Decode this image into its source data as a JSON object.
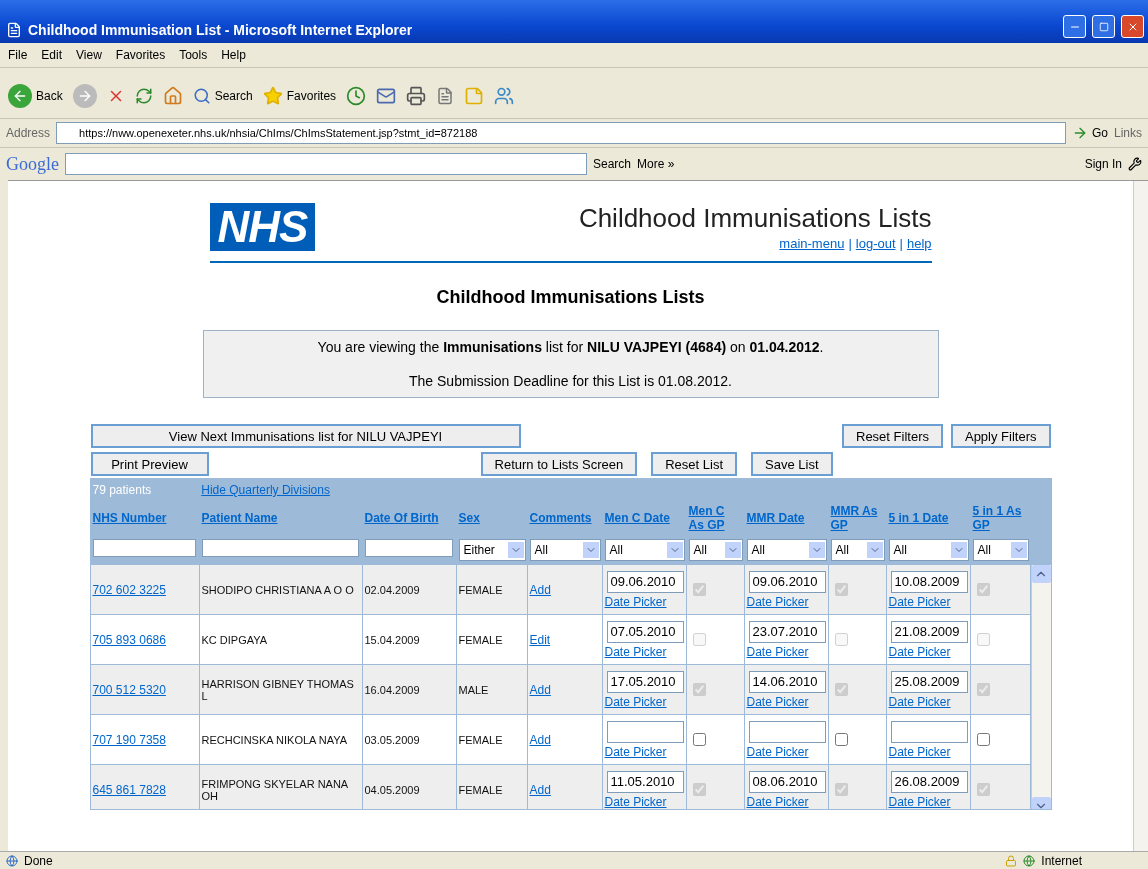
{
  "window": {
    "title": "Childhood Immunisation List - Microsoft Internet Explorer"
  },
  "menu": [
    "File",
    "Edit",
    "View",
    "Favorites",
    "Tools",
    "Help"
  ],
  "toolbar": {
    "back": "Back",
    "search": "Search",
    "favorites": "Favorites"
  },
  "address_bar": {
    "label": "Address",
    "url": "https://nww.openexeter.nhs.uk/nhsia/ChIms/ChImsStatement.jsp?stmt_id=872188",
    "go": "Go",
    "links": "Links"
  },
  "google_bar": {
    "logo": "Google",
    "search": "Search",
    "more": "More »",
    "sign_in": "Sign In"
  },
  "page": {
    "logo": "NHS",
    "title": "Childhood Immunisations Lists",
    "links": [
      {
        "label": "main-menu"
      },
      {
        "label": "log-out"
      },
      {
        "label": "help"
      }
    ],
    "separator": "|",
    "heading": "Childhood Immunisations Lists",
    "info": [
      "You are viewing the **Immunisations** list for **NILU VAJPEYI (4684)** on **01.04.2012**.",
      "The Submission Deadline for this List is 01.08.2012."
    ],
    "buttons_row1": {
      "left": "View Next Immunisations list for NILU VAJPEYI",
      "right": [
        "Reset Filters",
        "Apply Filters"
      ]
    },
    "buttons_row2": {
      "left": "Print Preview",
      "right": [
        "Return to Lists Screen",
        "Reset List",
        "Save List"
      ]
    },
    "table": {
      "count": "79 patients",
      "toggle": "Hide Quarterly Divisions",
      "columns": [
        {
          "label": "NHS Number",
          "filter": {
            "kind": "text"
          }
        },
        {
          "label": "Patient Name",
          "filter": {
            "kind": "text"
          }
        },
        {
          "label": "Date Of Birth",
          "filter": {
            "kind": "text"
          }
        },
        {
          "label": "Sex",
          "filter": {
            "kind": "select",
            "value": "Either"
          }
        },
        {
          "label": "Comments",
          "filter": {
            "kind": "select",
            "value": "All"
          }
        },
        {
          "label": "Men C Date",
          "filter": {
            "kind": "select",
            "value": "All"
          }
        },
        {
          "label": "Men C As GP",
          "filter": {
            "kind": "select",
            "value": "All"
          }
        },
        {
          "label": "MMR Date",
          "filter": {
            "kind": "select",
            "value": "All"
          }
        },
        {
          "label": "MMR As GP",
          "filter": {
            "kind": "select",
            "value": "All"
          }
        },
        {
          "label": "5 in 1 Date",
          "filter": {
            "kind": "select",
            "value": "All"
          }
        },
        {
          "label": "5 in 1 As GP",
          "filter": {
            "kind": "select",
            "value": "All"
          }
        }
      ],
      "rows": [
        {
          "nhs": "702 602 3225",
          "name": "SHODIPO CHRISTIANA A O O",
          "dob": "02.04.2009",
          "sex": "FEMALE",
          "comment": "Add",
          "vaccines": [
            {
              "date": "09.06.2010",
              "picker": "Date Picker",
              "checked": true,
              "disabled": true
            },
            {
              "date": "09.06.2010",
              "picker": "Date Picker",
              "checked": true,
              "disabled": true
            },
            {
              "date": "10.08.2009",
              "picker": "Date Picker",
              "checked": true,
              "disabled": true
            }
          ]
        },
        {
          "nhs": "705 893 0686",
          "name": "KC DIPGAYA",
          "dob": "15.04.2009",
          "sex": "FEMALE",
          "comment": "Edit",
          "vaccines": [
            {
              "date": "07.05.2010",
              "picker": "Date Picker",
              "checked": false,
              "disabled": true
            },
            {
              "date": "23.07.2010",
              "picker": "Date Picker",
              "checked": false,
              "disabled": true
            },
            {
              "date": "21.08.2009",
              "picker": "Date Picker",
              "checked": false,
              "disabled": true
            }
          ]
        },
        {
          "nhs": "700 512 5320",
          "name": "HARRISON GIBNEY THOMAS L",
          "dob": "16.04.2009",
          "sex": "MALE",
          "comment": "Add",
          "vaccines": [
            {
              "date": "17.05.2010",
              "picker": "Date Picker",
              "checked": true,
              "disabled": true
            },
            {
              "date": "14.06.2010",
              "picker": "Date Picker",
              "checked": true,
              "disabled": true
            },
            {
              "date": "25.08.2009",
              "picker": "Date Picker",
              "checked": true,
              "disabled": true
            }
          ]
        },
        {
          "nhs": "707 190 7358",
          "name": "RECHCINSKA NIKOLA NAYA",
          "dob": "03.05.2009",
          "sex": "FEMALE",
          "comment": "Add",
          "vaccines": [
            {
              "picker": "Date Picker",
              "checked": false,
              "disabled": false
            },
            {
              "picker": "Date Picker",
              "checked": false,
              "disabled": false
            },
            {
              "picker": "Date Picker",
              "checked": false,
              "disabled": false
            }
          ]
        },
        {
          "nhs": "645 861 7828",
          "name": "FRIMPONG SKYELAR NANA OH",
          "dob": "04.05.2009",
          "sex": "FEMALE",
          "comment": "Add",
          "vaccines": [
            {
              "date": "11.05.2010",
              "picker": "Date Picker",
              "checked": true,
              "disabled": true
            },
            {
              "date": "08.06.2010",
              "picker": "Date Picker",
              "checked": true,
              "disabled": true
            },
            {
              "date": "26.08.2009",
              "picker": "Date Picker",
              "checked": true,
              "disabled": true
            }
          ]
        }
      ]
    }
  },
  "status_bar": {
    "text": "Done",
    "zone": "Internet"
  }
}
